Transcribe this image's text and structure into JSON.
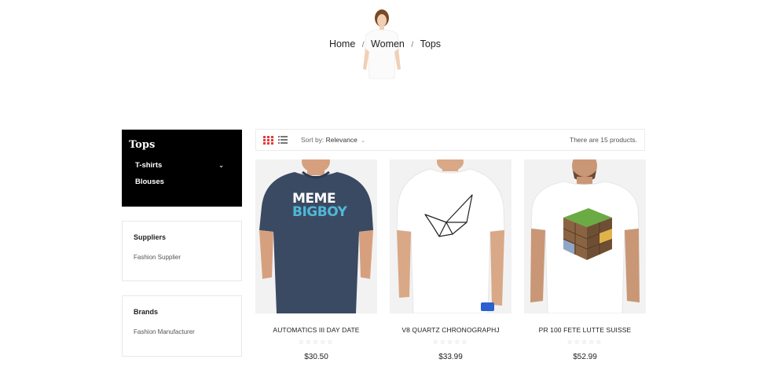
{
  "breadcrumb": {
    "home": "Home",
    "women": "Women",
    "tops": "Tops",
    "separator": "/"
  },
  "sidebar": {
    "category_title": "Tops",
    "categories": [
      {
        "label": "T-shirts",
        "expand_icon": "chevron-down-icon"
      },
      {
        "label": "Blouses"
      }
    ],
    "suppliers": {
      "title": "Suppliers",
      "item": "Fashion Supplier"
    },
    "brands": {
      "title": "Brands",
      "item": "Fashion Manufacturer"
    }
  },
  "toolbar": {
    "grid_view_icon": "grid-view-icon",
    "list_view_icon": "list-view-icon",
    "sort_label": "Sort by:",
    "sort_value": "Relevance",
    "count_text": "There are 15 products."
  },
  "products": [
    {
      "name": "AUTOMATICS III DAY DATE",
      "stars": "☆☆☆☆☆",
      "price": "$30.50",
      "print": {
        "line1": "MEME",
        "line2": "BIGBOY"
      }
    },
    {
      "name": "V8 QUARTZ CHRONOGRAPHJ",
      "stars": "☆☆☆☆☆",
      "price": "$33.99"
    },
    {
      "name": "PR 100 FETE LUTTE SUISSE",
      "stars": "☆☆☆☆☆",
      "price": "$52.99"
    }
  ],
  "colors": {
    "accent": "#e53935",
    "category_bg": "#000000",
    "shirt_navy": "#3b4a63"
  }
}
